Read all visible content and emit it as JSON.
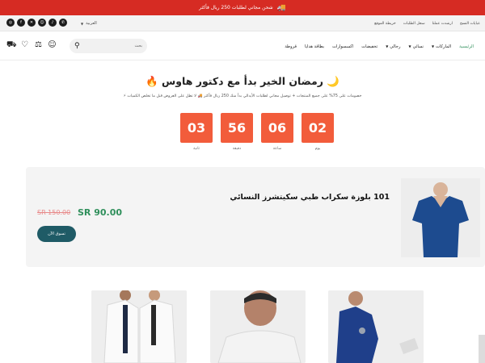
{
  "announcement": {
    "text": "شحن مجاني لطلبات 250 ريال فأكثر",
    "icon": "truck-icon"
  },
  "utility": {
    "links": [
      "عبايات النسخ",
      "ارشدت عملنا",
      "سجل الطلبات",
      "خريطة الموقع"
    ],
    "language": "العربية",
    "socials": [
      "instagram-icon",
      "facebook-icon",
      "x-icon",
      "snapchat-icon",
      "tiktok-icon",
      "whatsapp-icon"
    ]
  },
  "nav": {
    "items": [
      "الرئيسية",
      "الماركات",
      "نسائي",
      "رجالي",
      "تخفيضات",
      "اكسسوارات",
      "بطاقة هدايا",
      "قروطة"
    ],
    "active_color": "#2f8f5b"
  },
  "search": {
    "placeholder": "بحث"
  },
  "hero": {
    "title": "🌙 رمضان الخير بدأ مع دكتور هاوس 🔥",
    "subtitle": "خصومات على 75% على جميع المنتجات + توصيل مجاني لطلبات الأيدالي بدأ منك 250 ريال فأكثر 🚚 لا تطل على العروض قبل ما تخلص الكميات ⚡"
  },
  "countdown": [
    {
      "value": "02",
      "label": "يوم"
    },
    {
      "value": "06",
      "label": "ساعة"
    },
    {
      "value": "56",
      "label": "دقيقة"
    },
    {
      "value": "03",
      "label": "ثانية"
    }
  ],
  "product": {
    "name": "101 بلوزة سكراب طبي سكيتشرز النسائي",
    "old_price": "SR 150.00",
    "new_price": "SR 90.00",
    "cta": "تسوق الآن"
  },
  "colors": {
    "accent": "#d62b23",
    "countdown": "#f25c3b",
    "price": "#2f8f5b",
    "button": "#1f5b66"
  }
}
